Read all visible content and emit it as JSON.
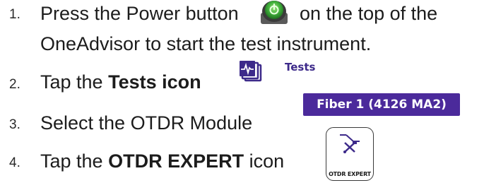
{
  "steps": [
    {
      "number": "1.",
      "line1_before": "Press the Power button",
      "line1_after": "on the top of the",
      "line2": "OneAdvisor to start the test instrument."
    },
    {
      "number": "2.",
      "before": "Tap the ",
      "bold": "Tests icon"
    },
    {
      "number": "3.",
      "text": "Select the OTDR Module"
    },
    {
      "number": "4.",
      "before": "Tap the ",
      "bold": "OTDR EXPERT",
      "after": " icon"
    }
  ],
  "icons": {
    "power": "power-button-icon",
    "tests": "tests-icon",
    "otdr": "otdr-expert-icon"
  },
  "tests_label": "Tests",
  "fiber_badge": "Fiber 1 (4126 MA2)",
  "otdr_caption": "OTDR EXPERT",
  "colors": {
    "badge_bg": "#4b2a9b",
    "tests_icon": "#3d2a8a",
    "power_green": "#3fae3a"
  }
}
